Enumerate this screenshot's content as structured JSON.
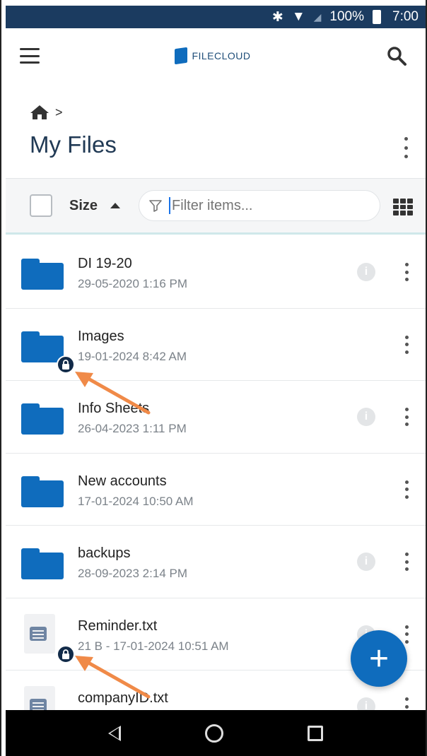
{
  "status_bar": {
    "icons": [
      "bluetooth-icon",
      "wifi-icon",
      "signal-icon"
    ],
    "battery": "100%",
    "time": "7:00"
  },
  "app_bar": {
    "brand": "FILECLOUD"
  },
  "breadcrumb": {
    "home_icon": "home-icon",
    "separator": ">"
  },
  "page": {
    "title": "My Files"
  },
  "toolbar": {
    "sort_label": "Size",
    "filter_placeholder": "Filter items..."
  },
  "items": [
    {
      "name": "DI 19-20",
      "meta": "29-05-2020 1:16 PM",
      "type": "folder",
      "locked": false
    },
    {
      "name": "Images",
      "meta": "19-01-2024 8:42 AM",
      "type": "folder",
      "locked": true
    },
    {
      "name": "Info Sheets",
      "meta": "26-04-2023 1:11 PM",
      "type": "folder",
      "locked": false
    },
    {
      "name": "New accounts",
      "meta": "17-01-2024 10:50 AM",
      "type": "folder",
      "locked": false
    },
    {
      "name": "backups",
      "meta": "28-09-2023 2:14 PM",
      "type": "folder",
      "locked": false
    },
    {
      "name": "Reminder.txt",
      "meta": "21 B - 17-01-2024 10:51 AM",
      "type": "file",
      "locked": true
    },
    {
      "name": "companyID.txt",
      "meta": "",
      "type": "file",
      "locked": false
    }
  ],
  "colors": {
    "status_bar": "#1b3b60",
    "accent": "#0f6cbd",
    "title": "#213a55",
    "annotation_arrow": "#f08a48"
  }
}
